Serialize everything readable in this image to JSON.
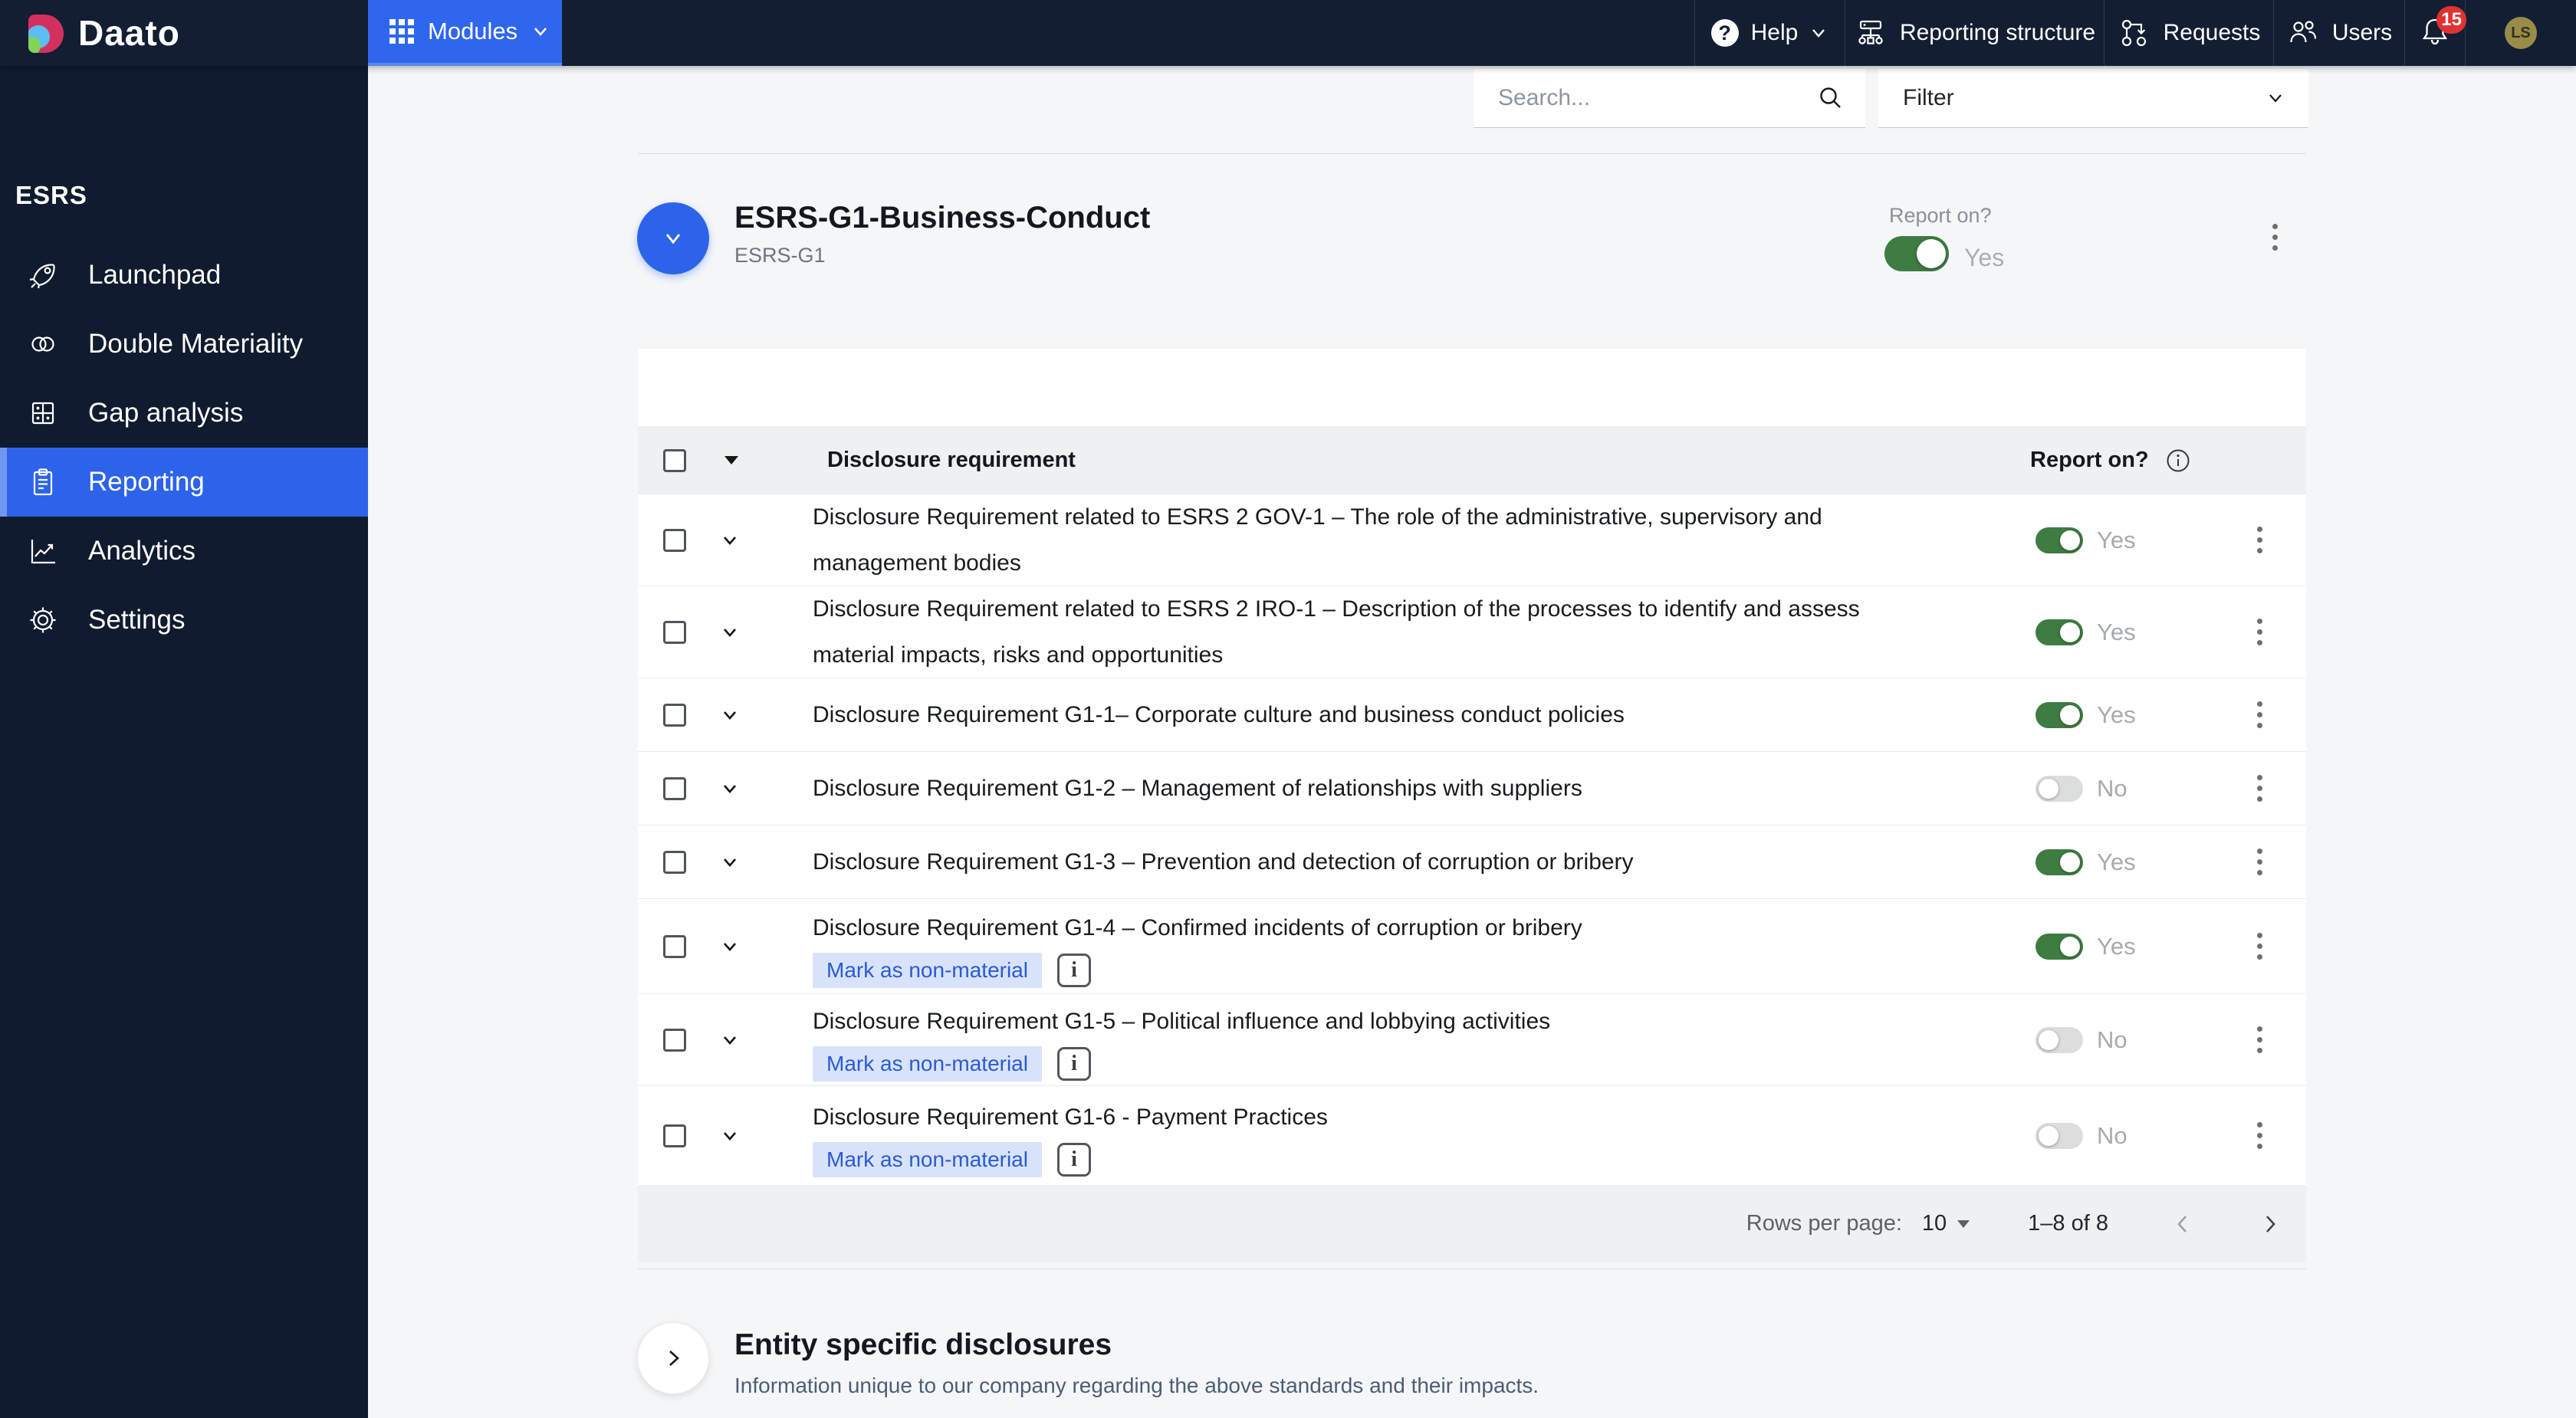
{
  "topbar": {
    "logo_text": "Daato",
    "modules_label": "Modules",
    "help_label": "Help",
    "reporting_structure_label": "Reporting structure",
    "requests_label": "Requests",
    "users_label": "Users",
    "notification_count": "15",
    "avatar_initials": "LS"
  },
  "sidebar": {
    "section_label": "ESRS",
    "items": [
      {
        "label": "Launchpad",
        "icon": "rocket-icon",
        "selected": false
      },
      {
        "label": "Double Materiality",
        "icon": "double-circles-icon",
        "selected": false
      },
      {
        "label": "Gap analysis",
        "icon": "quadrant-grid-icon",
        "selected": false
      },
      {
        "label": "Reporting",
        "icon": "clipboard-icon",
        "selected": true
      },
      {
        "label": "Analytics",
        "icon": "line-chart-icon",
        "selected": false
      },
      {
        "label": "Settings",
        "icon": "gear-icon",
        "selected": false
      }
    ]
  },
  "toolbar": {
    "search_placeholder": "Search...",
    "filter_label": "Filter"
  },
  "section_header": {
    "title": "ESRS-G1-Business-Conduct",
    "subtitle": "ESRS-G1",
    "report_on_label": "Report on?",
    "toggle_state_label": "Yes",
    "toggle_on": true
  },
  "table": {
    "header": {
      "disclosure": "Disclosure requirement",
      "report_on": "Report on?"
    },
    "rows": [
      {
        "title": "Disclosure Requirement related to ESRS 2 GOV-1 – The role of the administrative, supervisory and management bodies",
        "report_on": "Yes",
        "on": true,
        "chip": null
      },
      {
        "title": "Disclosure Requirement related to ESRS 2 IRO-1 – Description of the processes to identify and assess material impacts, risks and opportunities",
        "report_on": "Yes",
        "on": true,
        "chip": null
      },
      {
        "title": "Disclosure Requirement G1-1– Corporate culture and business conduct policies",
        "report_on": "Yes",
        "on": true,
        "chip": null
      },
      {
        "title": "Disclosure Requirement G1-2 – Management of relationships with suppliers",
        "report_on": "No",
        "on": false,
        "chip": null
      },
      {
        "title": "Disclosure Requirement G1-3 – Prevention and detection of corruption or bribery",
        "report_on": "Yes",
        "on": true,
        "chip": null
      },
      {
        "title": "Disclosure Requirement G1-4 – Confirmed incidents of corruption or bribery",
        "report_on": "Yes",
        "on": true,
        "chip": "Mark as non-material"
      },
      {
        "title": "Disclosure Requirement G1-5 – Political influence and lobbying activities",
        "report_on": "No",
        "on": false,
        "chip": "Mark as non-material"
      },
      {
        "title": "Disclosure Requirement G1-6 - Payment Practices",
        "report_on": "No",
        "on": false,
        "chip": "Mark as non-material"
      }
    ],
    "pagination": {
      "rows_per_page_label": "Rows per page:",
      "rows_per_page_value": "10",
      "range_label": "1–8 of 8"
    }
  },
  "entity_section": {
    "title": "Entity specific disclosures",
    "subtitle": "Information unique to our company regarding the above standards and their impacts."
  },
  "colors": {
    "topbar_bg": "#131e33",
    "sidebar_bg": "#101b2f",
    "accent_blue": "#2c63ea",
    "toggle_on_green": "#3e7c42",
    "toggle_off_gray": "#dcdede",
    "chip_bg": "#d8e3fb",
    "chip_text": "#2a5ad4",
    "badge_red": "#e03232",
    "avatar_bg": "#9a8b49"
  }
}
